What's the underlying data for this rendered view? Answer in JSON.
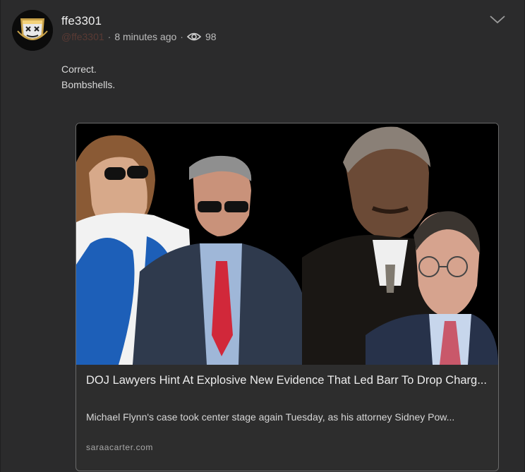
{
  "post": {
    "username": "ffe3301",
    "handle": "@ffe3301",
    "separator": "·",
    "time_ago": "8 minutes ago",
    "view_count": "98",
    "body_lines": [
      "Correct.",
      "Bombshells."
    ]
  },
  "link_card": {
    "title": "DOJ Lawyers Hint At Explosive New Evidence That Led Barr To Drop Charg...",
    "description": "Michael Flynn's case took center stage again Tuesday, as his attorney Sidney Pow...",
    "domain": "saraacarter.com"
  },
  "icons": {
    "avatar": "shield-mask-avatar",
    "views": "eye-icon",
    "menu": "chevron-down-icon"
  },
  "colors": {
    "background": "#2b2b2c",
    "handle": "#5a3a34",
    "card_border": "#6a6a6a"
  }
}
